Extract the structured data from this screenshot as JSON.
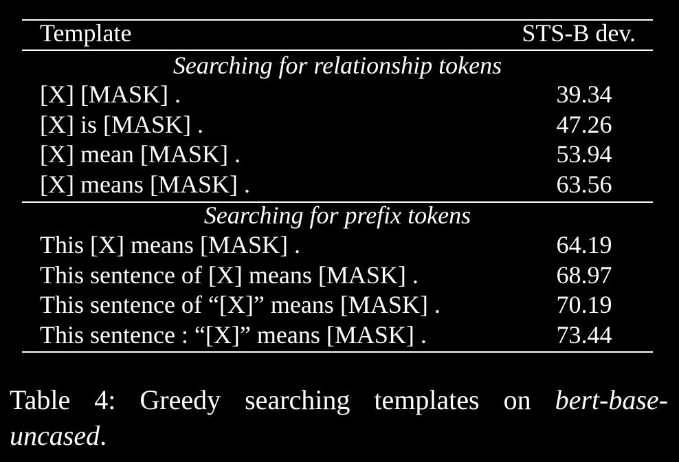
{
  "table": {
    "header": {
      "template": "Template",
      "score": "STS-B dev."
    },
    "sections": [
      {
        "title": "Searching for relationship tokens",
        "rows": [
          {
            "template": "[X] [MASK] .",
            "score": "39.34"
          },
          {
            "template": "[X] is [MASK] .",
            "score": "47.26"
          },
          {
            "template": "[X] mean [MASK] .",
            "score": "53.94"
          },
          {
            "template": "[X] means [MASK] .",
            "score": "63.56"
          }
        ]
      },
      {
        "title": "Searching for prefix tokens",
        "rows": [
          {
            "template": "This [X] means [MASK] .",
            "score": "64.19"
          },
          {
            "template": "This sentence of [X] means [MASK] .",
            "score": "68.97"
          },
          {
            "template": "This sentence of “[X]” means [MASK] .",
            "score": "70.19"
          },
          {
            "template": "This sentence : “[X]” means [MASK] .",
            "score": "73.44"
          }
        ]
      }
    ]
  },
  "caption": {
    "label": "Table 4:",
    "text": "Greedy searching templates on",
    "model": "bert-base-uncased",
    "end": "."
  }
}
